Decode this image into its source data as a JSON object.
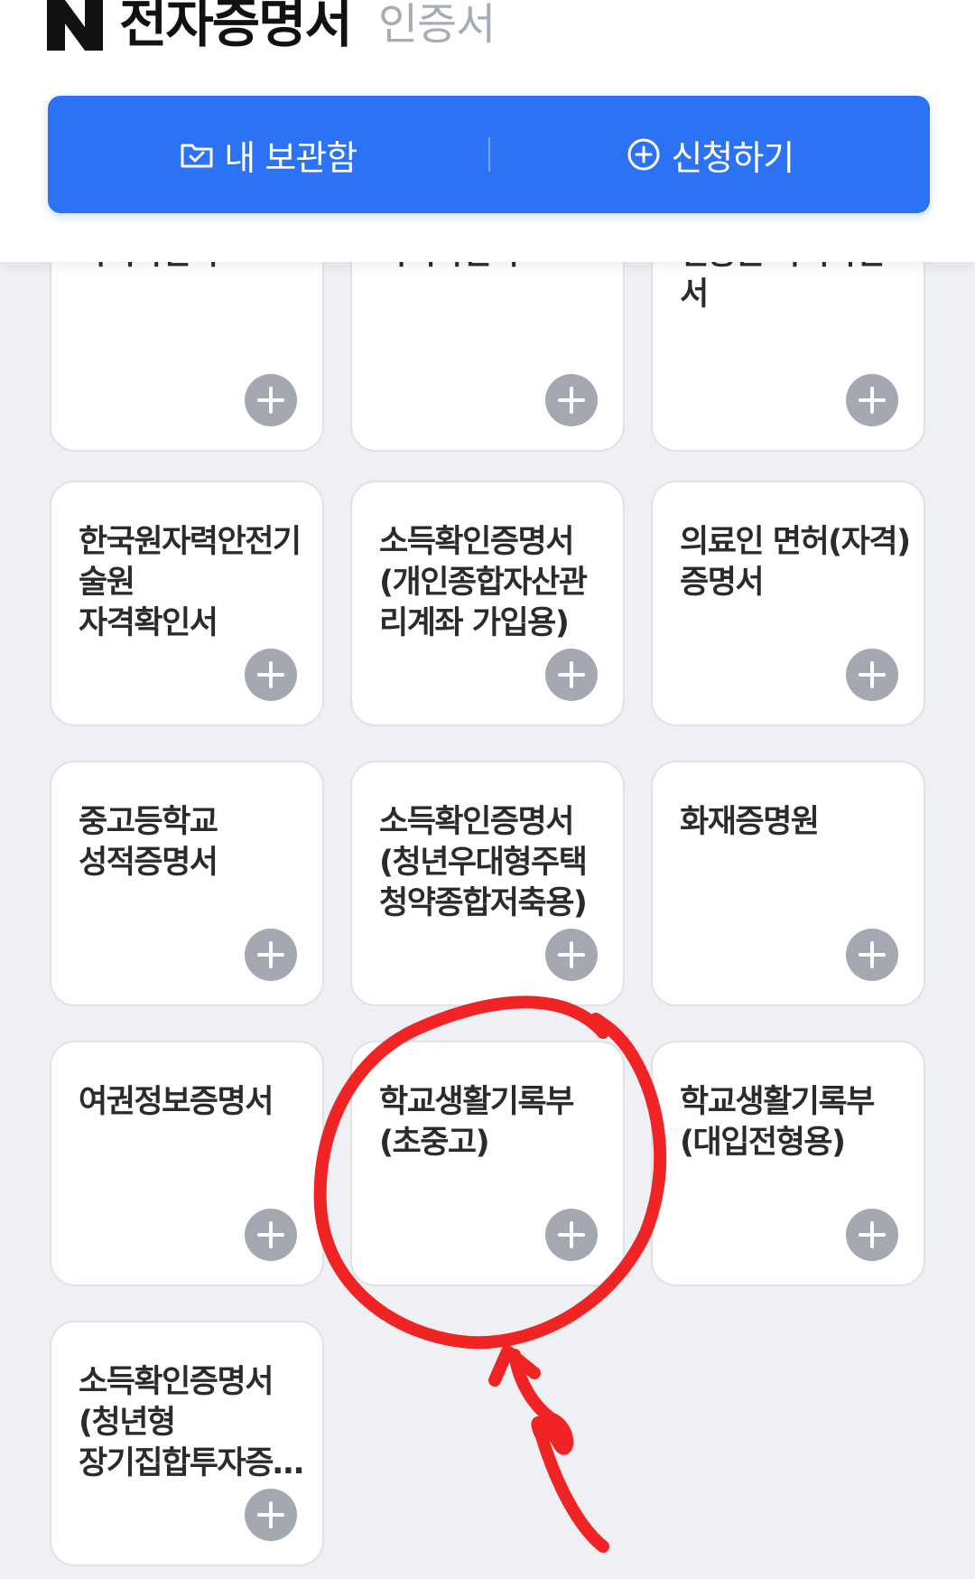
{
  "header": {
    "title": "전자증명서",
    "subtitle": "인증서",
    "my_box_label": "내 보관함",
    "apply_label": "신청하기"
  },
  "cards": [
    {
      "title": "한국인터넷진흥원 자격확인서",
      "cut": true
    },
    {
      "title": "방송통신위원회 자격확인서",
      "cut": true
    },
    {
      "title": "한국방송통신전파진흥원 자격확인서",
      "cut": true
    },
    {
      "title": "한국원자력안전기술원\n자격확인서"
    },
    {
      "title": "소득확인증명서(개인종합자산관리계좌 가입용)"
    },
    {
      "title": "의료인 면허(자격)증명서"
    },
    {
      "title": "중고등학교\n성적증명서"
    },
    {
      "title": "소득확인증명서(청년우대형주택청약종합저축용)"
    },
    {
      "title": "화재증명원"
    },
    {
      "title": "여권정보증명서"
    },
    {
      "title": "학교생활기록부(초중고)"
    },
    {
      "title": "학교생활기록부(대입전형용)"
    },
    {
      "title": "소득확인증명서(청년형\n장기집합투자증권저축용)"
    }
  ],
  "colors": {
    "accent": "#2b72f5",
    "annotation": "#f02424"
  }
}
